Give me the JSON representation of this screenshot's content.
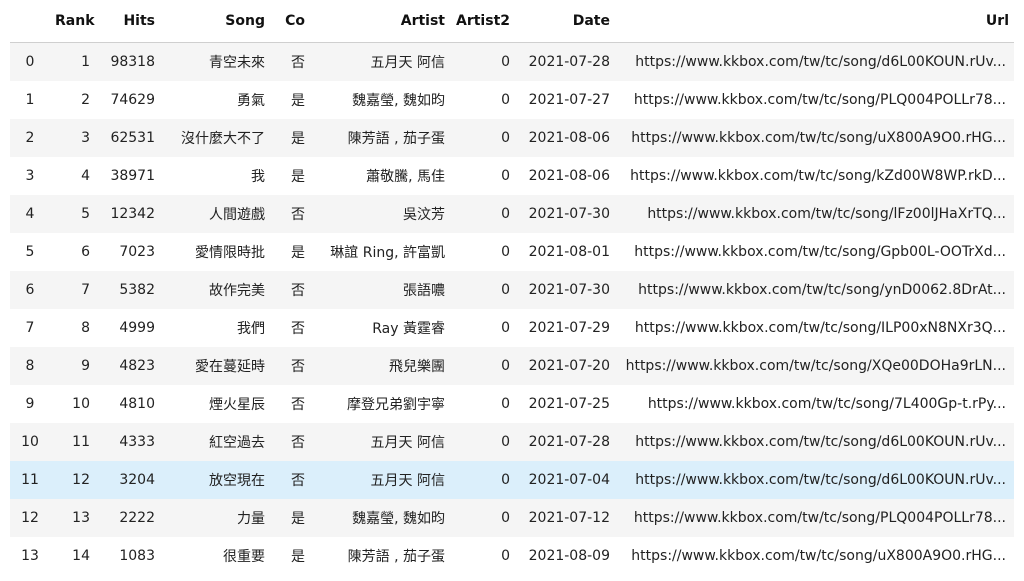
{
  "columns": [
    "",
    "Rank",
    "Hits",
    "Song",
    "Co",
    "Artist",
    "Artist2",
    "Date",
    "Url"
  ],
  "rows": [
    {
      "index": "0",
      "rank": "1",
      "hits": "98318",
      "song": "青空未來",
      "co": "否",
      "artist": "五月天 阿信",
      "artist2": "0",
      "date": "2021-07-28",
      "url": "https://www.kkbox.com/tw/tc/song/d6L00KOUN.rUv..."
    },
    {
      "index": "1",
      "rank": "2",
      "hits": "74629",
      "song": "勇氣",
      "co": "是",
      "artist": "魏嘉瑩, 魏如昀",
      "artist2": "0",
      "date": "2021-07-27",
      "url": "https://www.kkbox.com/tw/tc/song/PLQ004POLLr78..."
    },
    {
      "index": "2",
      "rank": "3",
      "hits": "62531",
      "song": "沒什麼大不了",
      "co": "是",
      "artist": "陳芳語 , 茄子蛋",
      "artist2": "0",
      "date": "2021-08-06",
      "url": "https://www.kkbox.com/tw/tc/song/uX800A9O0.rHG..."
    },
    {
      "index": "3",
      "rank": "4",
      "hits": "38971",
      "song": "我",
      "co": "是",
      "artist": "蕭敬騰, 馬佳",
      "artist2": "0",
      "date": "2021-08-06",
      "url": "https://www.kkbox.com/tw/tc/song/kZd00W8WP.rkD..."
    },
    {
      "index": "4",
      "rank": "5",
      "hits": "12342",
      "song": "人間遊戲",
      "co": "否",
      "artist": "吳汶芳",
      "artist2": "0",
      "date": "2021-07-30",
      "url": "https://www.kkbox.com/tw/tc/song/lFz00lJHaXrTQ..."
    },
    {
      "index": "5",
      "rank": "6",
      "hits": "7023",
      "song": "愛情限時批",
      "co": "是",
      "artist": "琳誼 Ring, 許富凱",
      "artist2": "0",
      "date": "2021-08-01",
      "url": "https://www.kkbox.com/tw/tc/song/Gpb00L-OOTrXd..."
    },
    {
      "index": "6",
      "rank": "7",
      "hits": "5382",
      "song": "故作完美",
      "co": "否",
      "artist": "張語噥",
      "artist2": "0",
      "date": "2021-07-30",
      "url": "https://www.kkbox.com/tw/tc/song/ynD0062.8DrAt..."
    },
    {
      "index": "7",
      "rank": "8",
      "hits": "4999",
      "song": "我們",
      "co": "否",
      "artist": "Ray 黃霆睿",
      "artist2": "0",
      "date": "2021-07-29",
      "url": "https://www.kkbox.com/tw/tc/song/ILP00xN8NXr3Q..."
    },
    {
      "index": "8",
      "rank": "9",
      "hits": "4823",
      "song": "愛在蔓延時",
      "co": "否",
      "artist": "飛兒樂團",
      "artist2": "0",
      "date": "2021-07-20",
      "url": "https://www.kkbox.com/tw/tc/song/XQe00DOHa9rLN..."
    },
    {
      "index": "9",
      "rank": "10",
      "hits": "4810",
      "song": "煙火星辰",
      "co": "否",
      "artist": "摩登兄弟劉宇寧",
      "artist2": "0",
      "date": "2021-07-25",
      "url": "https://www.kkbox.com/tw/tc/song/7L400Gp-t.rPy..."
    },
    {
      "index": "10",
      "rank": "11",
      "hits": "4333",
      "song": "紅空過去",
      "co": "否",
      "artist": "五月天 阿信",
      "artist2": "0",
      "date": "2021-07-28",
      "url": "https://www.kkbox.com/tw/tc/song/d6L00KOUN.rUv..."
    },
    {
      "index": "11",
      "rank": "12",
      "hits": "3204",
      "song": "放空現在",
      "co": "否",
      "artist": "五月天 阿信",
      "artist2": "0",
      "date": "2021-07-04",
      "url": "https://www.kkbox.com/tw/tc/song/d6L00KOUN.rUv..."
    },
    {
      "index": "12",
      "rank": "13",
      "hits": "2222",
      "song": "力量",
      "co": "是",
      "artist": "魏嘉瑩, 魏如昀",
      "artist2": "0",
      "date": "2021-07-12",
      "url": "https://www.kkbox.com/tw/tc/song/PLQ004POLLr78..."
    },
    {
      "index": "13",
      "rank": "14",
      "hits": "1083",
      "song": "很重要",
      "co": "是",
      "artist": "陳芳語 , 茄子蛋",
      "artist2": "0",
      "date": "2021-08-09",
      "url": "https://www.kkbox.com/tw/tc/song/uX800A9O0.rHG..."
    }
  ],
  "highlight_row": 11,
  "colors": {
    "stripe": "#f5f5f5",
    "highlight": "#dbeffb",
    "header_border": "#cfcfcf"
  }
}
